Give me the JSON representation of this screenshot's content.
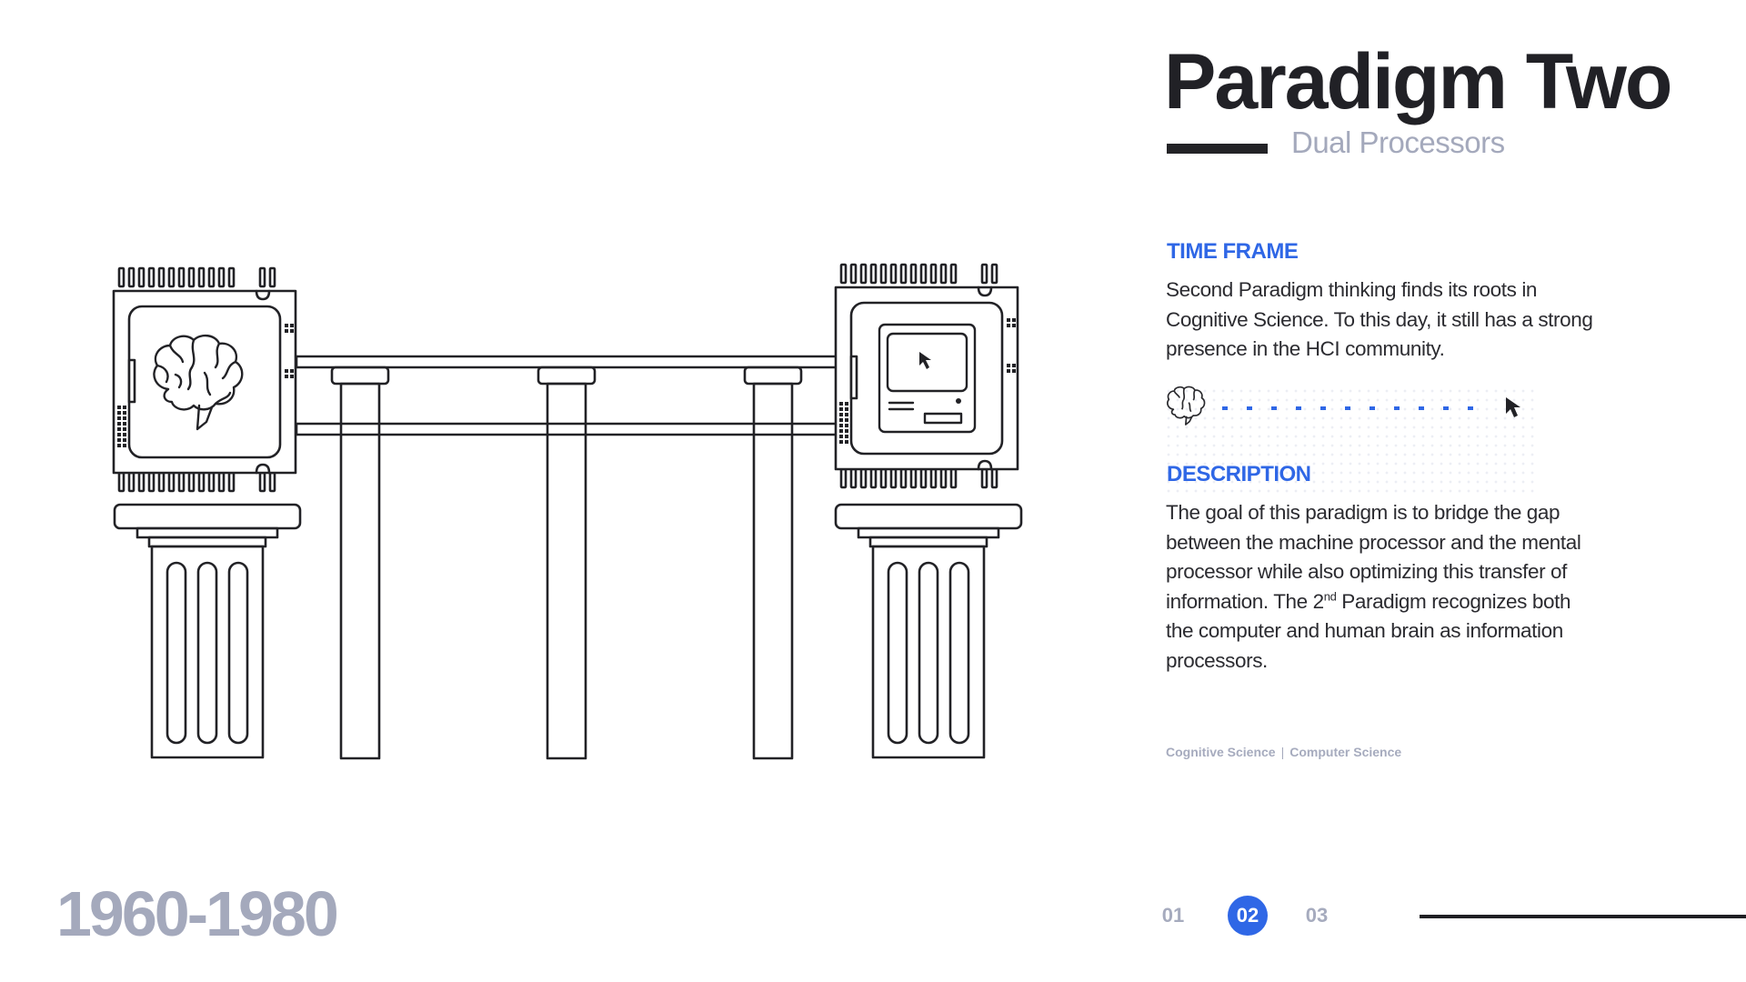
{
  "header": {
    "title": "Paradigm Two",
    "subtitle": "Dual Processors"
  },
  "time_frame": {
    "heading": "TIME FRAME",
    "text": "Second Paradigm thinking finds its roots in Cognitive Science. To this day, it still has a strong presence in the HCI community."
  },
  "description": {
    "heading": "DESCRIPTION",
    "text_before": "The goal of this paradigm is to bridge the gap between the machine processor and the mental processor while also optimizing this transfer of information. The 2",
    "superscript": "nd",
    "text_after": " Paradigm recognizes both the computer and human brain as  information processors."
  },
  "tags": {
    "first": "Cognitive Science",
    "separator": "|",
    "second": "Computer Science"
  },
  "years": "1960-1980",
  "pager": {
    "pages": [
      "01",
      "02",
      "03"
    ],
    "active": "02"
  },
  "icons": {
    "left_chip": "brain-icon",
    "right_chip": "retro-computer-icon",
    "transfer_start": "brain-icon",
    "transfer_end": "cursor-icon"
  },
  "colors": {
    "accent": "#2f67e6",
    "muted": "#a4a9bc",
    "ink": "#262629"
  }
}
